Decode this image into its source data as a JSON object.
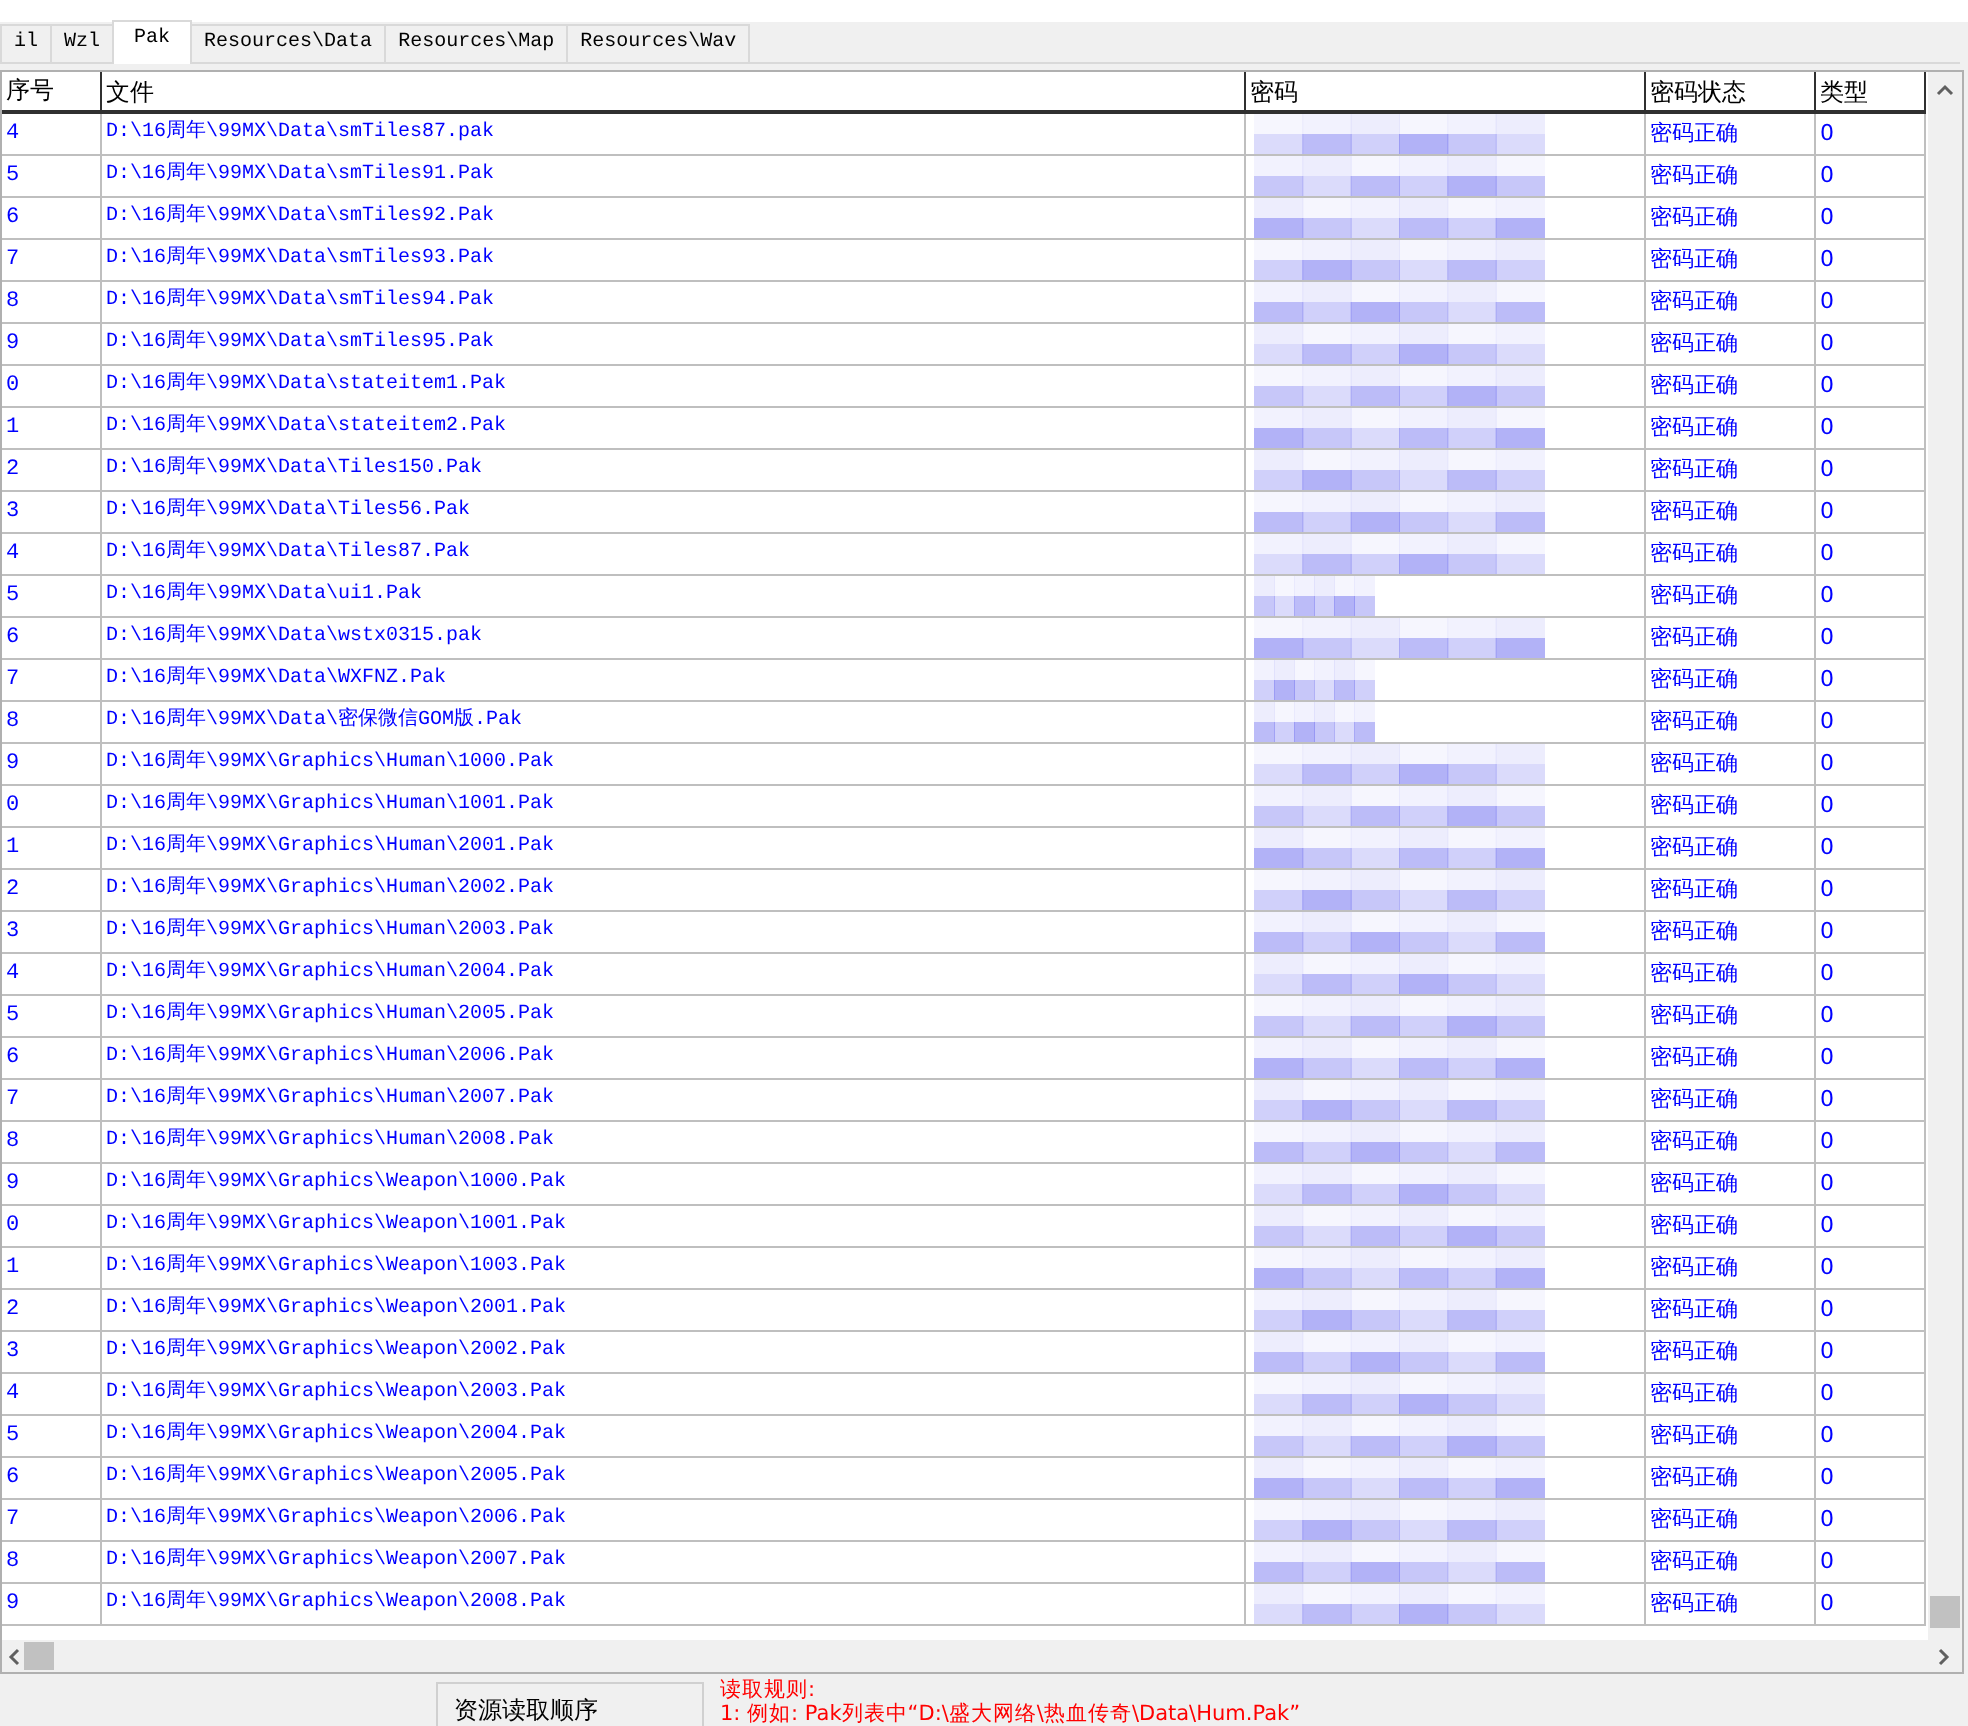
{
  "tabs": [
    {
      "label": "il",
      "selected": false
    },
    {
      "label": "Wzl",
      "selected": false
    },
    {
      "label": "Pak",
      "selected": true
    },
    {
      "label": "Resources\\Data",
      "selected": false
    },
    {
      "label": "Resources\\Map",
      "selected": false
    },
    {
      "label": "Resources\\Wav",
      "selected": false
    }
  ],
  "table": {
    "columns": [
      "序号",
      "文件",
      "密码",
      "密码状态",
      "类型"
    ],
    "rows": [
      {
        "index": "4",
        "file": "D:\\16周年\\99MX\\Data\\smTiles87.pak",
        "status": "密码正确",
        "type": "0"
      },
      {
        "index": "5",
        "file": "D:\\16周年\\99MX\\Data\\smTiles91.Pak",
        "status": "密码正确",
        "type": "0"
      },
      {
        "index": "6",
        "file": "D:\\16周年\\99MX\\Data\\smTiles92.Pak",
        "status": "密码正确",
        "type": "0"
      },
      {
        "index": "7",
        "file": "D:\\16周年\\99MX\\Data\\smTiles93.Pak",
        "status": "密码正确",
        "type": "0"
      },
      {
        "index": "8",
        "file": "D:\\16周年\\99MX\\Data\\smTiles94.Pak",
        "status": "密码正确",
        "type": "0"
      },
      {
        "index": "9",
        "file": "D:\\16周年\\99MX\\Data\\smTiles95.Pak",
        "status": "密码正确",
        "type": "0"
      },
      {
        "index": "0",
        "file": "D:\\16周年\\99MX\\Data\\stateitem1.Pak",
        "status": "密码正确",
        "type": "0"
      },
      {
        "index": "1",
        "file": "D:\\16周年\\99MX\\Data\\stateitem2.Pak",
        "status": "密码正确",
        "type": "0"
      },
      {
        "index": "2",
        "file": "D:\\16周年\\99MX\\Data\\Tiles150.Pak",
        "status": "密码正确",
        "type": "0"
      },
      {
        "index": "3",
        "file": "D:\\16周年\\99MX\\Data\\Tiles56.Pak",
        "status": "密码正确",
        "type": "0"
      },
      {
        "index": "4",
        "file": "D:\\16周年\\99MX\\Data\\Tiles87.Pak",
        "status": "密码正确",
        "type": "0"
      },
      {
        "index": "5",
        "file": "D:\\16周年\\99MX\\Data\\ui1.Pak",
        "status": "密码正确",
        "type": "0"
      },
      {
        "index": "6",
        "file": "D:\\16周年\\99MX\\Data\\wstx0315.pak",
        "status": "密码正确",
        "type": "0"
      },
      {
        "index": "7",
        "file": "D:\\16周年\\99MX\\Data\\WXFNZ.Pak",
        "status": "密码正确",
        "type": "0"
      },
      {
        "index": "8",
        "file": "D:\\16周年\\99MX\\Data\\密保微信GOM版.Pak",
        "status": "密码正确",
        "type": "0"
      },
      {
        "index": "9",
        "file": "D:\\16周年\\99MX\\Graphics\\Human\\1000.Pak",
        "status": "密码正确",
        "type": "0"
      },
      {
        "index": "0",
        "file": "D:\\16周年\\99MX\\Graphics\\Human\\1001.Pak",
        "status": "密码正确",
        "type": "0"
      },
      {
        "index": "1",
        "file": "D:\\16周年\\99MX\\Graphics\\Human\\2001.Pak",
        "status": "密码正确",
        "type": "0"
      },
      {
        "index": "2",
        "file": "D:\\16周年\\99MX\\Graphics\\Human\\2002.Pak",
        "status": "密码正确",
        "type": "0"
      },
      {
        "index": "3",
        "file": "D:\\16周年\\99MX\\Graphics\\Human\\2003.Pak",
        "status": "密码正确",
        "type": "0"
      },
      {
        "index": "4",
        "file": "D:\\16周年\\99MX\\Graphics\\Human\\2004.Pak",
        "status": "密码正确",
        "type": "0"
      },
      {
        "index": "5",
        "file": "D:\\16周年\\99MX\\Graphics\\Human\\2005.Pak",
        "status": "密码正确",
        "type": "0"
      },
      {
        "index": "6",
        "file": "D:\\16周年\\99MX\\Graphics\\Human\\2006.Pak",
        "status": "密码正确",
        "type": "0"
      },
      {
        "index": "7",
        "file": "D:\\16周年\\99MX\\Graphics\\Human\\2007.Pak",
        "status": "密码正确",
        "type": "0"
      },
      {
        "index": "8",
        "file": "D:\\16周年\\99MX\\Graphics\\Human\\2008.Pak",
        "status": "密码正确",
        "type": "0"
      },
      {
        "index": "9",
        "file": "D:\\16周年\\99MX\\Graphics\\Weapon\\1000.Pak",
        "status": "密码正确",
        "type": "0"
      },
      {
        "index": "0",
        "file": "D:\\16周年\\99MX\\Graphics\\Weapon\\1001.Pak",
        "status": "密码正确",
        "type": "0"
      },
      {
        "index": "1",
        "file": "D:\\16周年\\99MX\\Graphics\\Weapon\\1003.Pak",
        "status": "密码正确",
        "type": "0"
      },
      {
        "index": "2",
        "file": "D:\\16周年\\99MX\\Graphics\\Weapon\\2001.Pak",
        "status": "密码正确",
        "type": "0"
      },
      {
        "index": "3",
        "file": "D:\\16周年\\99MX\\Graphics\\Weapon\\2002.Pak",
        "status": "密码正确",
        "type": "0"
      },
      {
        "index": "4",
        "file": "D:\\16周年\\99MX\\Graphics\\Weapon\\2003.Pak",
        "status": "密码正确",
        "type": "0"
      },
      {
        "index": "5",
        "file": "D:\\16周年\\99MX\\Graphics\\Weapon\\2004.Pak",
        "status": "密码正确",
        "type": "0"
      },
      {
        "index": "6",
        "file": "D:\\16周年\\99MX\\Graphics\\Weapon\\2005.Pak",
        "status": "密码正确",
        "type": "0"
      },
      {
        "index": "7",
        "file": "D:\\16周年\\99MX\\Graphics\\Weapon\\2006.Pak",
        "status": "密码正确",
        "type": "0"
      },
      {
        "index": "8",
        "file": "D:\\16周年\\99MX\\Graphics\\Weapon\\2007.Pak",
        "status": "密码正确",
        "type": "0"
      },
      {
        "index": "9",
        "file": "D:\\16周年\\99MX\\Graphics\\Weapon\\2008.Pak",
        "status": "密码正确",
        "type": "0"
      }
    ]
  },
  "footer": {
    "order_label": "资源读取顺序",
    "rules_title": "读取规则:",
    "rules_line": "1: 例如: Pak列表中“D:\\盛大网络\\热血传奇\\Data\\Hum.Pak”"
  }
}
